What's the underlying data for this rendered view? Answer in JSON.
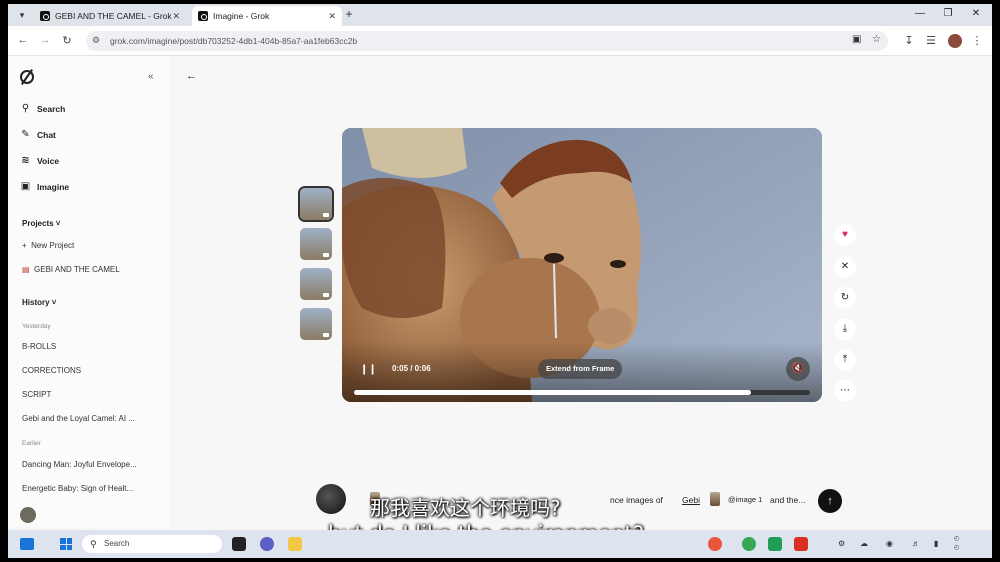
{
  "browser": {
    "tabs": [
      {
        "label": "GEBI AND THE CAMEL - Grok",
        "active": false
      },
      {
        "label": "Imagine - Grok",
        "active": true
      }
    ],
    "url": "grok.com/imagine/post/db703252-4db1-404b-85a7-aa1feb63cc2b"
  },
  "sidebar": {
    "nav": [
      {
        "label": "Search",
        "icon": "search-icon"
      },
      {
        "label": "Chat",
        "icon": "chat-icon"
      },
      {
        "label": "Voice",
        "icon": "voice-icon"
      },
      {
        "label": "Imagine",
        "icon": "imagine-icon"
      }
    ],
    "projects_heading": "Projects",
    "new_project": "New Project",
    "project_item": "GEBI AND THE CAMEL",
    "history_heading": "History",
    "yesterday_label": "Yesterday",
    "yesterday_items": [
      "B-ROLLS",
      "CORRECTIONS",
      "SCRIPT",
      "Gebi and the Loyal Camel: AI ..."
    ],
    "earlier_label": "Earlier",
    "earlier_items": [
      "Dancing Man: Joyful Envelope...",
      "Energetic Baby: Sign of Healt..."
    ]
  },
  "video": {
    "time": "0:05 / 0:06",
    "extend_label": "Extend from Frame",
    "progress": 0.87,
    "muted": true,
    "thumbnails": 4
  },
  "actions": [
    "heart-icon",
    "close-icon",
    "regenerate-icon",
    "download-icon",
    "share-icon",
    "more-icon"
  ],
  "composer": {
    "text_part1": "nce images of",
    "text_gebi": "Gebi",
    "text_ref": "@image 1",
    "text_part2": "and the..."
  },
  "subtitles": {
    "zh": "那我喜欢这个环境吗?",
    "en": "but do I like the environment?"
  },
  "taskbar": {
    "search_placeholder": "Search"
  },
  "colors": {
    "accent": "#111111",
    "heart": "#e0245e",
    "taskbar": "#dde4ef"
  }
}
